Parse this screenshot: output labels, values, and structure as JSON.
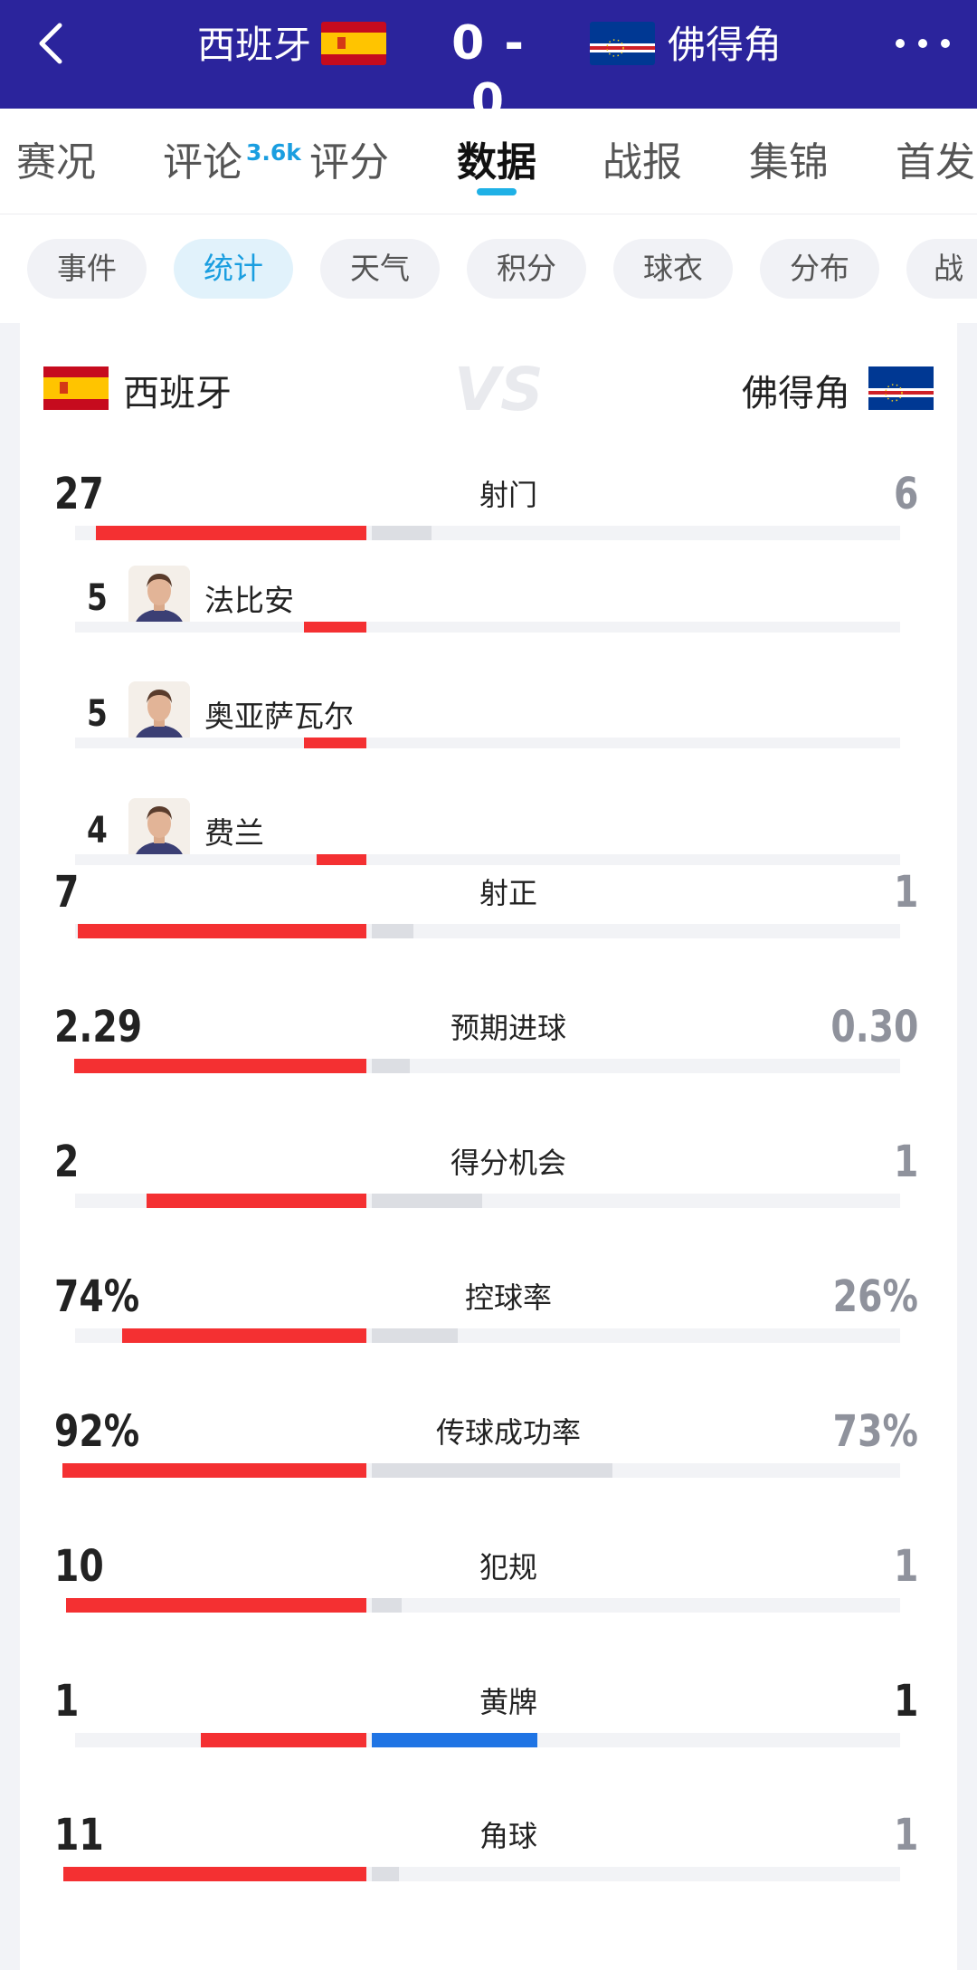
{
  "header": {
    "home_team": "西班牙",
    "away_team": "佛得角",
    "score": "0 - 0",
    "back_icon": "chevron-left-icon",
    "more_icon": "more-dots-icon"
  },
  "tabs": {
    "items": [
      "赛况",
      "评论",
      "评分",
      "数据",
      "战报",
      "集锦",
      "首发"
    ],
    "comment_badge": "3.6k",
    "active": "数据"
  },
  "subtabs": {
    "items": [
      "事件",
      "统计",
      "天气",
      "积分",
      "球衣",
      "分布",
      "战"
    ],
    "active": "统计"
  },
  "card": {
    "home_team": "西班牙",
    "away_team": "佛得角",
    "vs": "VS"
  },
  "stats": [
    {
      "label": "射门",
      "home": "27",
      "away": "6",
      "home_share": 0.82,
      "away_share": 0.18
    },
    {
      "label": "射正",
      "home": "7",
      "away": "1",
      "home_share": 0.875,
      "away_share": 0.125
    },
    {
      "label": "预期进球",
      "home": "2.29",
      "away": "0.30",
      "home_share": 0.884,
      "away_share": 0.116
    },
    {
      "label": "得分机会",
      "home": "2",
      "away": "1",
      "home_share": 0.667,
      "away_share": 0.333
    },
    {
      "label": "控球率",
      "home": "74%",
      "away": "26%",
      "home_share": 0.74,
      "away_share": 0.26
    },
    {
      "label": "传球成功率",
      "home": "92%",
      "away": "73%",
      "home_share": 0.92,
      "away_share": 0.73
    },
    {
      "label": "犯规",
      "home": "10",
      "away": "1",
      "home_share": 0.909,
      "away_share": 0.091
    },
    {
      "label": "黄牌",
      "home": "1",
      "away": "1",
      "home_share": 0.5,
      "away_share": 0.5
    },
    {
      "label": "角球",
      "home": "11",
      "away": "1",
      "home_share": 0.917,
      "away_share": 0.083
    }
  ],
  "top_shooters": [
    {
      "name": "法比安",
      "shots": "5",
      "share": 0.19
    },
    {
      "name": "奥亚萨瓦尔",
      "shots": "5",
      "share": 0.19
    },
    {
      "name": "费兰",
      "shots": "4",
      "share": 0.15
    }
  ],
  "colors": {
    "header_bg": "#2b249c",
    "home_bar": "#f43032",
    "away_bar": "#dcdee3",
    "away_bar_card": "#1f74e4",
    "accent": "#1a9ee0"
  }
}
